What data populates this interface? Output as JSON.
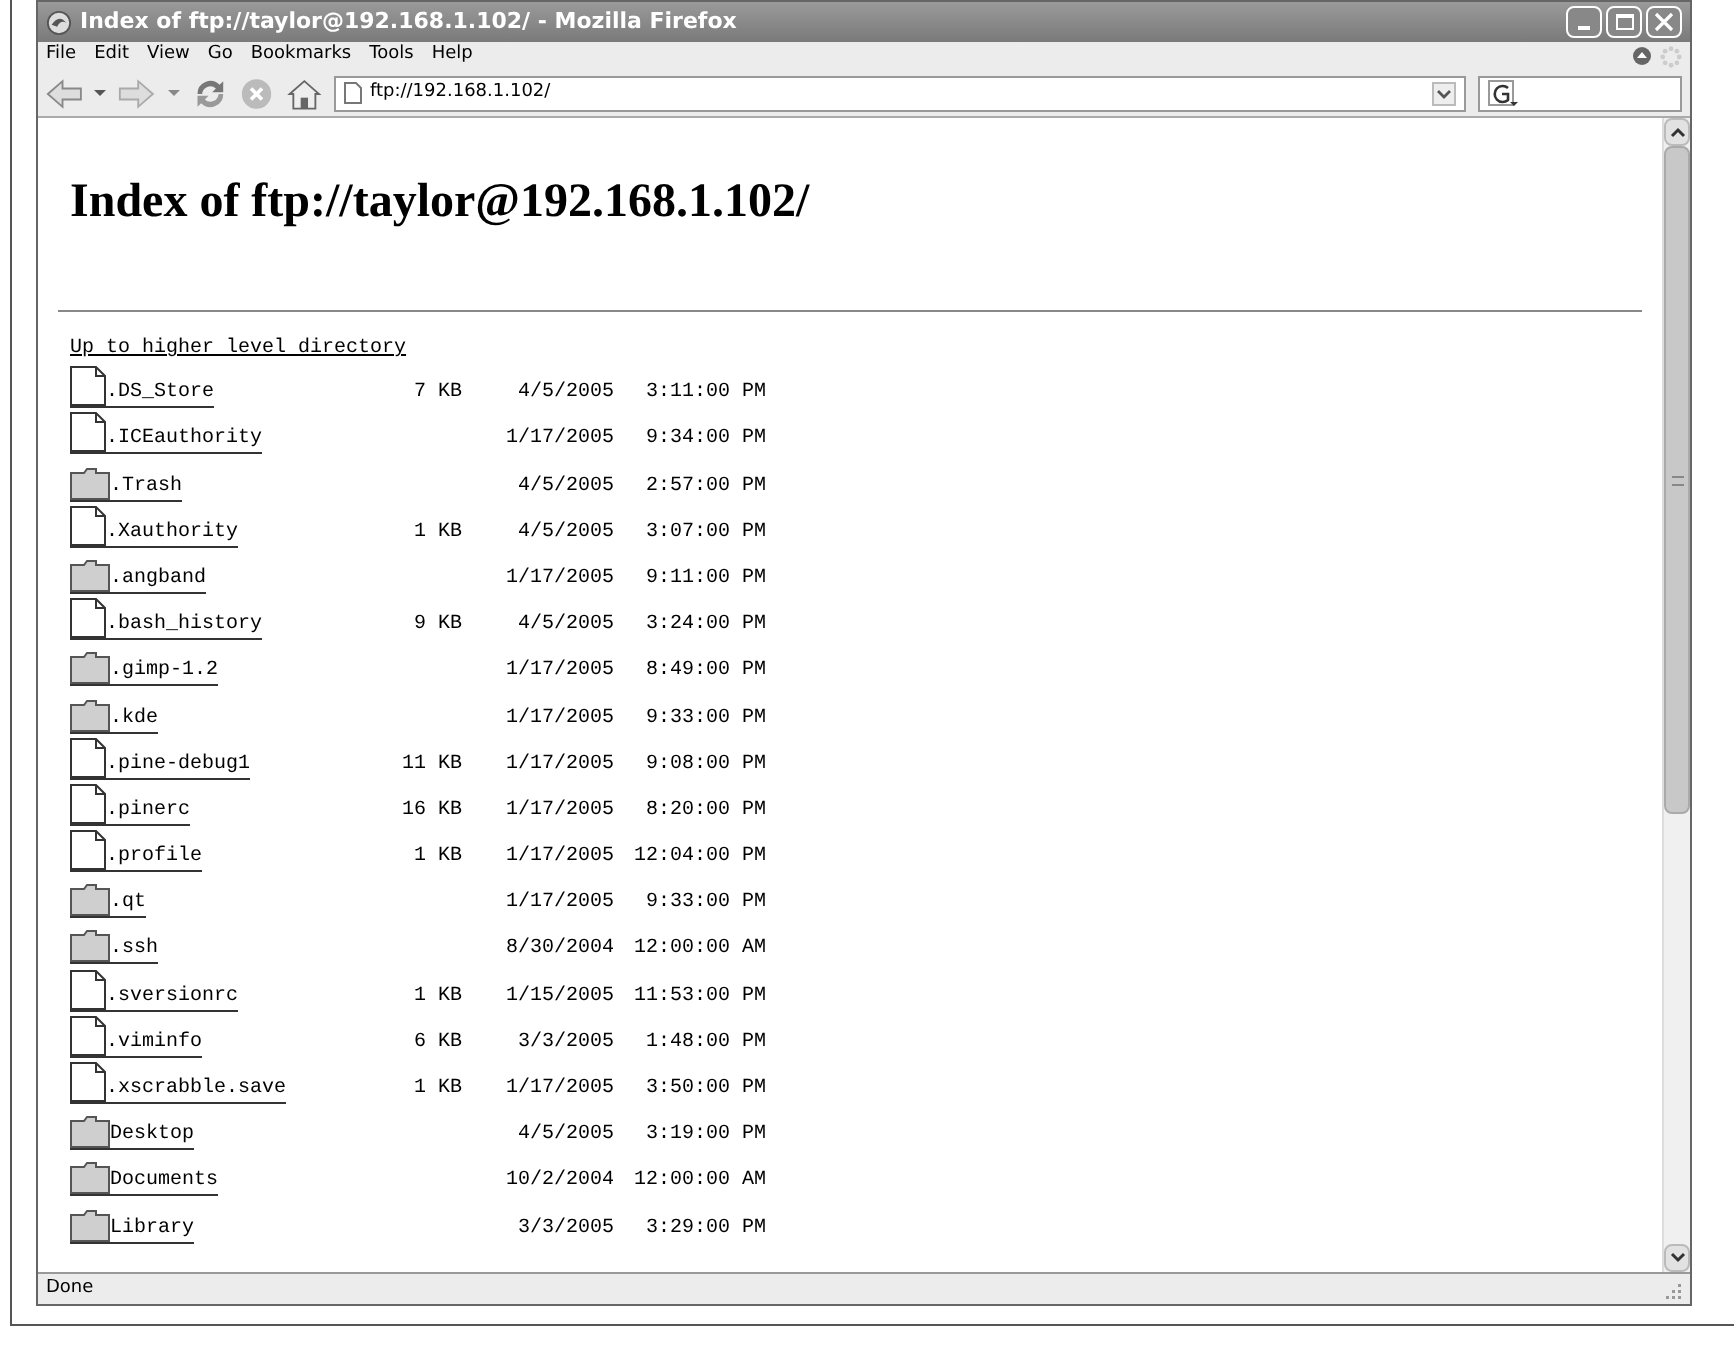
{
  "window": {
    "title": "Index of ftp://taylor@192.168.1.102/ - Mozilla Firefox"
  },
  "menu": [
    "File",
    "Edit",
    "View",
    "Go",
    "Bookmarks",
    "Tools",
    "Help"
  ],
  "toolbar": {
    "address": "ftp://192.168.1.102/"
  },
  "page": {
    "heading": "Index of ftp://taylor@192.168.1.102/",
    "up_link": "Up to higher level directory",
    "entries": [
      {
        "kind": "file",
        "name": ".DS_Store",
        "size": "7 KB",
        "date": "4/5/2005",
        "time": "3:11:00 PM"
      },
      {
        "kind": "file",
        "name": ".ICEauthority",
        "date": "1/17/2005",
        "time": "9:34:00 PM"
      },
      {
        "kind": "folder",
        "name": ".Trash",
        "date": "4/5/2005",
        "time": "2:57:00 PM"
      },
      {
        "kind": "file",
        "name": ".Xauthority",
        "size": "1 KB",
        "date": "4/5/2005",
        "time": "3:07:00 PM"
      },
      {
        "kind": "folder",
        "name": ".angband",
        "date": "1/17/2005",
        "time": "9:11:00 PM"
      },
      {
        "kind": "file",
        "name": ".bash_history",
        "size": "9 KB",
        "date": "4/5/2005",
        "time": "3:24:00 PM"
      },
      {
        "kind": "folder",
        "name": ".gimp-1.2",
        "date": "1/17/2005",
        "time": "8:49:00 PM"
      },
      {
        "kind": "folder",
        "name": ".kde",
        "date": "1/17/2005",
        "time": "9:33:00 PM"
      },
      {
        "kind": "file",
        "name": ".pine-debug1",
        "size": "11 KB",
        "date": "1/17/2005",
        "time": "9:08:00 PM"
      },
      {
        "kind": "file",
        "name": ".pinerc",
        "size": "16 KB",
        "date": "1/17/2005",
        "time": "8:20:00 PM"
      },
      {
        "kind": "file",
        "name": ".profile",
        "size": "1 KB",
        "date": "1/17/2005",
        "time": "12:04:00 PM"
      },
      {
        "kind": "folder",
        "name": ".qt",
        "date": "1/17/2005",
        "time": "9:33:00 PM"
      },
      {
        "kind": "folder",
        "name": ".ssh",
        "date": "8/30/2004",
        "time": "12:00:00 AM"
      },
      {
        "kind": "file",
        "name": ".sversionrc",
        "size": "1 KB",
        "date": "1/15/2005",
        "time": "11:53:00 PM"
      },
      {
        "kind": "file",
        "name": ".viminfo",
        "size": "6 KB",
        "date": "3/3/2005",
        "time": "1:48:00 PM"
      },
      {
        "kind": "file",
        "name": ".xscrabble.save",
        "size": "1 KB",
        "date": "1/17/2005",
        "time": "3:50:00 PM"
      },
      {
        "kind": "folder",
        "name": "Desktop",
        "date": "4/5/2005",
        "time": "3:19:00 PM"
      },
      {
        "kind": "folder",
        "name": "Documents",
        "date": "10/2/2004",
        "time": "12:00:00 AM"
      },
      {
        "kind": "folder",
        "name": "Library",
        "date": "3/3/2005",
        "time": "3:29:00 PM"
      }
    ]
  },
  "status_bar": {
    "text": "Done"
  }
}
